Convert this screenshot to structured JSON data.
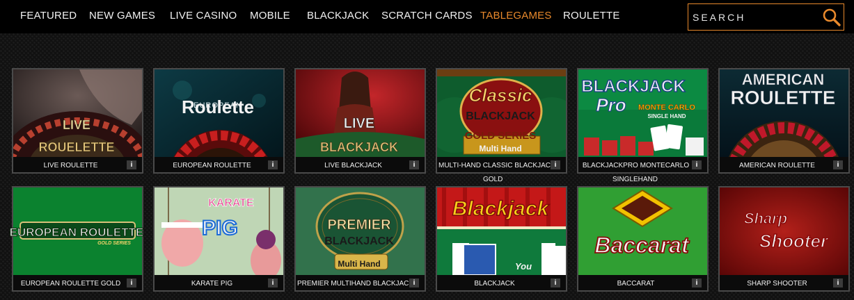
{
  "nav": {
    "items": [
      {
        "label": "FEATURED",
        "active": false
      },
      {
        "label": "NEW GAMES",
        "active": false
      },
      {
        "label": "LIVE CASINO",
        "active": false
      },
      {
        "label": "MOBILE",
        "active": false
      },
      {
        "label": "BLACKJACK",
        "active": false
      },
      {
        "label": "SCRATCH CARDS",
        "active": false
      },
      {
        "label": "TABLEGAMES",
        "active": true
      },
      {
        "label": "ROULETTE",
        "active": false
      }
    ],
    "search_placeholder": "SEARCH",
    "search_icon": "search-icon"
  },
  "colors": {
    "accent": "#e8892c",
    "background": "#111111",
    "nav_background": "#000000",
    "tile_border": "#4a4a4a",
    "info_badge": "#3b3b3b"
  },
  "games": [
    {
      "title": "LIVE ROULETTE",
      "art_text": [
        "LIVE",
        "ROUELETTE"
      ],
      "info_icon": "i"
    },
    {
      "title": "EUROPEAN ROULETTE",
      "art_text": [
        "EUROPEAN",
        "Roulette"
      ],
      "info_icon": "i"
    },
    {
      "title": "LIVE BLACKJACK",
      "art_text": [
        "LIVE",
        "BLACKJACK"
      ],
      "info_icon": "i"
    },
    {
      "title": "MULTI-HAND CLASSIC BLACKJACK",
      "title_line2": "GOLD",
      "art_text": [
        "Classic",
        "BLACKJACK",
        "GOLD SERIES",
        "Multi Hand"
      ],
      "info_icon": "i"
    },
    {
      "title": "BLACKJACKPRO MONTECARLO",
      "title_line2": "SINGLEHAND",
      "art_text": [
        "BLACKJACK",
        "Pro",
        "MONTE CARLO",
        "SINGLE HAND"
      ],
      "info_icon": "i"
    },
    {
      "title": "AMERICAN ROULETTE",
      "art_text": [
        "AMERICAN",
        "ROULETTE"
      ],
      "info_icon": "i"
    },
    {
      "title": "EUROPEAN ROULETTE GOLD",
      "art_text": [
        "EUROPEAN ROULETTE",
        "GOLD SERIES"
      ],
      "info_icon": "i"
    },
    {
      "title": "KARATE PIG",
      "art_text": [
        "KARATE",
        "PIG"
      ],
      "info_icon": "i"
    },
    {
      "title": "PREMIER MULTIHAND BLACKJACK",
      "art_text": [
        "PREMIER",
        "BLACKJACK",
        "Multi Hand"
      ],
      "info_icon": "i"
    },
    {
      "title": "BLACKJACK",
      "art_text": [
        "Blackjack",
        "You"
      ],
      "info_icon": "i"
    },
    {
      "title": "BACCARAT",
      "art_text": [
        "Baccarat"
      ],
      "info_icon": "i"
    },
    {
      "title": "SHARP SHOOTER",
      "art_text": [
        "Sharp",
        "Shooter"
      ],
      "info_icon": "i"
    }
  ]
}
